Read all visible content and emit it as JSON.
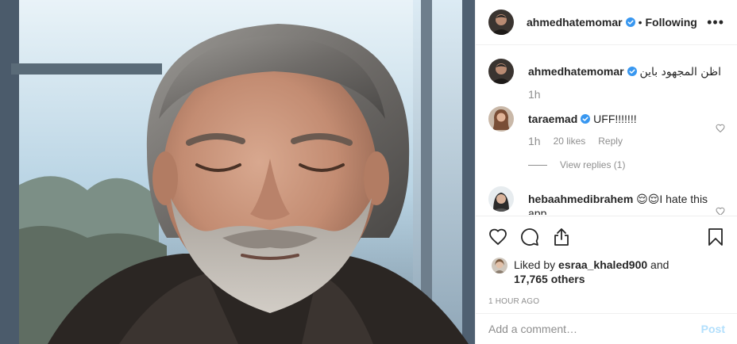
{
  "post": {
    "author": "ahmedhatemomar",
    "follow_status": "Following",
    "separator": "•",
    "more_label": "•••"
  },
  "comments": [
    {
      "username": "ahmedhatemomar",
      "verified": true,
      "text": "اظن المجهود باين",
      "time": "1h"
    },
    {
      "username": "taraemad",
      "verified": true,
      "text": "UFF!!!!!!!",
      "time": "1h",
      "likes": "20 likes",
      "reply": "Reply",
      "view_replies": "View replies (1)"
    },
    {
      "username": "hebaahmedibrahem",
      "verified": false,
      "text": "😌😌I hate this app"
    }
  ],
  "likes": {
    "prefix": "Liked by",
    "user": "esraa_khaled900",
    "and": "and",
    "others": "17,765 others"
  },
  "timestamp": "1 HOUR AGO",
  "add_comment": {
    "placeholder": "Add a comment…",
    "post_label": "Post"
  },
  "icons": [
    "verified-badge-icon",
    "more-options-icon",
    "heart-outline-icon",
    "comment-icon",
    "share-icon",
    "bookmark-icon"
  ],
  "colors": {
    "verified": "#3897f0",
    "muted": "#8e8e8e",
    "post_disabled": "#b2dffc",
    "text": "#262626"
  }
}
